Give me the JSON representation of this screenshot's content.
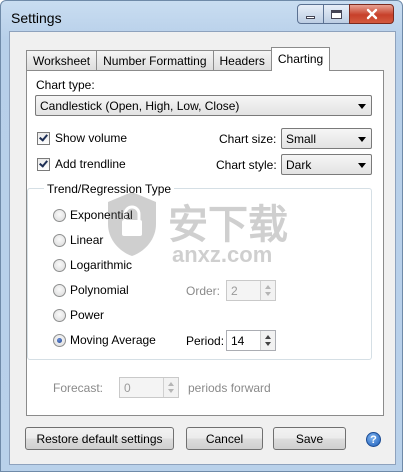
{
  "window": {
    "title": "Settings",
    "accent": "#c7402a"
  },
  "tabs": [
    "Worksheet",
    "Number Formatting",
    "Headers",
    "Charting"
  ],
  "active_tab": "Charting",
  "chart_type": {
    "label": "Chart type:",
    "value": "Candlestick (Open, High, Low, Close)"
  },
  "show_volume": {
    "label": "Show volume",
    "checked": true
  },
  "add_trendline": {
    "label": "Add trendline",
    "checked": true
  },
  "chart_size": {
    "label": "Chart size:",
    "value": "Small"
  },
  "chart_style": {
    "label": "Chart style:",
    "value": "Dark"
  },
  "trend_group": {
    "legend": "Trend/Regression Type",
    "options": [
      {
        "label": "Exponential",
        "selected": false
      },
      {
        "label": "Linear",
        "selected": false
      },
      {
        "label": "Logarithmic",
        "selected": false
      },
      {
        "label": "Polynomial",
        "selected": false
      },
      {
        "label": "Power",
        "selected": false
      },
      {
        "label": "Moving Average",
        "selected": true
      }
    ],
    "order_label": "Order:",
    "order_value": "2",
    "period_label": "Period:",
    "period_value": "14"
  },
  "forecast": {
    "label": "Forecast:",
    "value": "0",
    "suffix": "periods forward"
  },
  "buttons": {
    "restore": "Restore default settings",
    "cancel": "Cancel",
    "save": "Save"
  },
  "watermark": {
    "text_cn": "安下载",
    "text_en": "anxz.com"
  }
}
